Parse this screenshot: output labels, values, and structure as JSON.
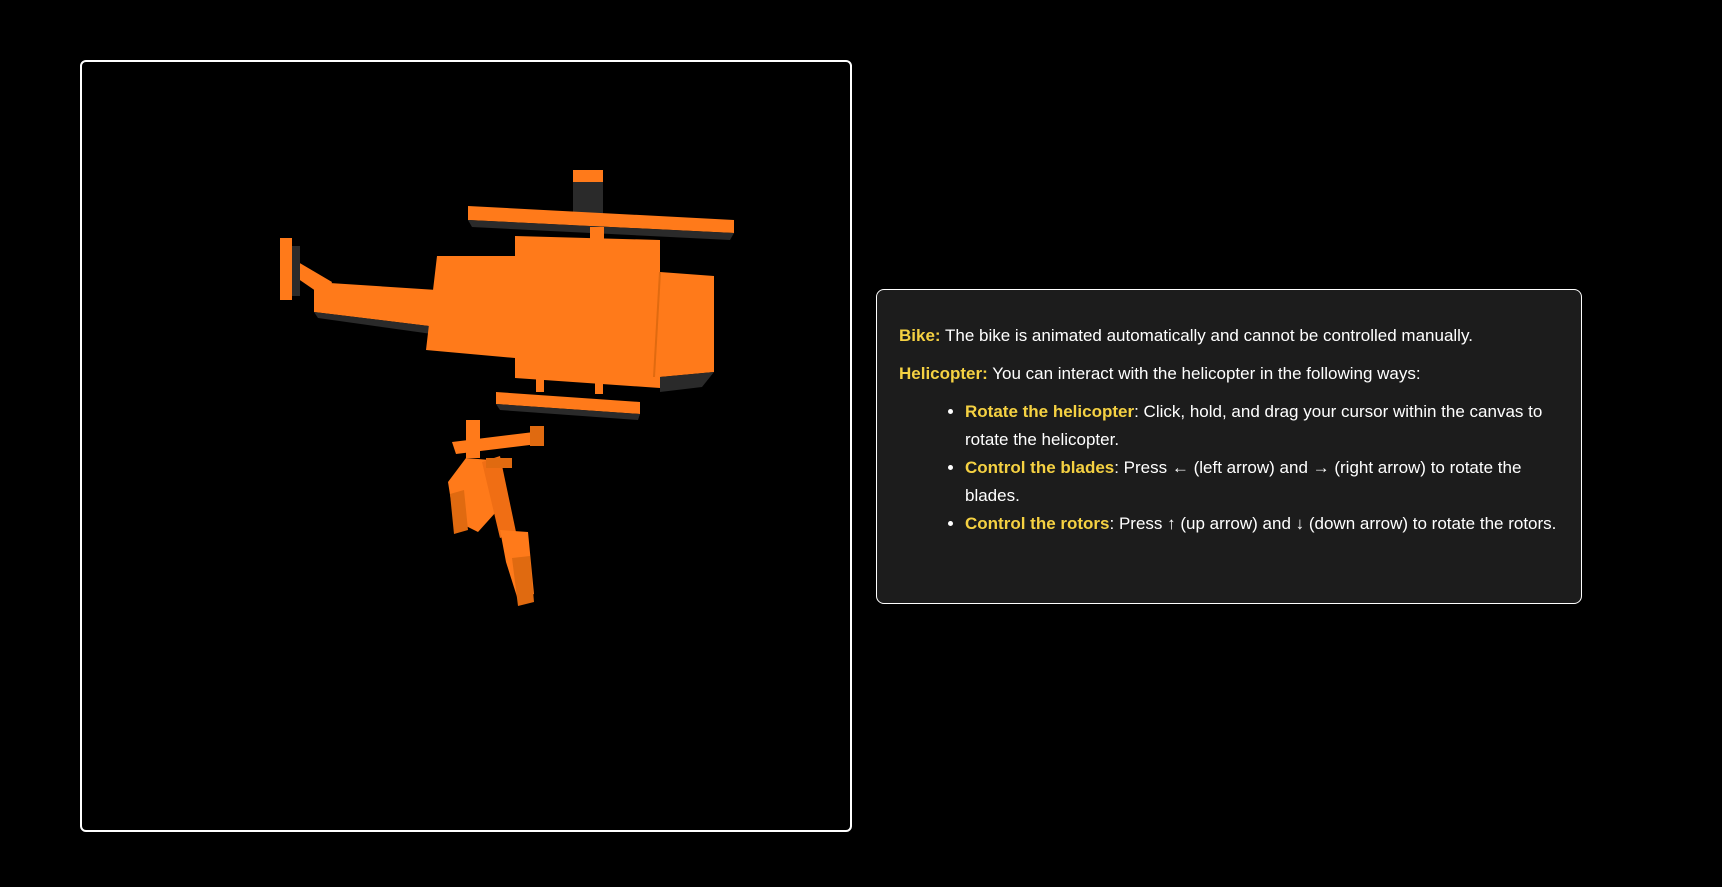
{
  "colors": {
    "background": "#000000",
    "panel_background": "#1c1c1c",
    "highlight": "#f5d142",
    "model_orange": "#ff7a1a",
    "model_shadow": "#2a2a2a"
  },
  "scene": {
    "objects": [
      "helicopter",
      "bike"
    ]
  },
  "info": {
    "bike_label": "Bike:",
    "bike_text": " The bike is animated automatically and cannot be controlled manually.",
    "helicopter_label": "Helicopter:",
    "helicopter_text": " You can interact with the helicopter in the following ways:",
    "items": [
      {
        "label": "Rotate the helicopter",
        "text": ": Click, hold, and drag your cursor within the canvas to rotate the helicopter."
      },
      {
        "label": "Control the blades",
        "text": ": Press ← (left arrow) and → (right arrow) to rotate the blades."
      },
      {
        "label": "Control the rotors",
        "text": ": Press ↑ (up arrow) and ↓ (down arrow) to rotate the rotors."
      }
    ]
  }
}
